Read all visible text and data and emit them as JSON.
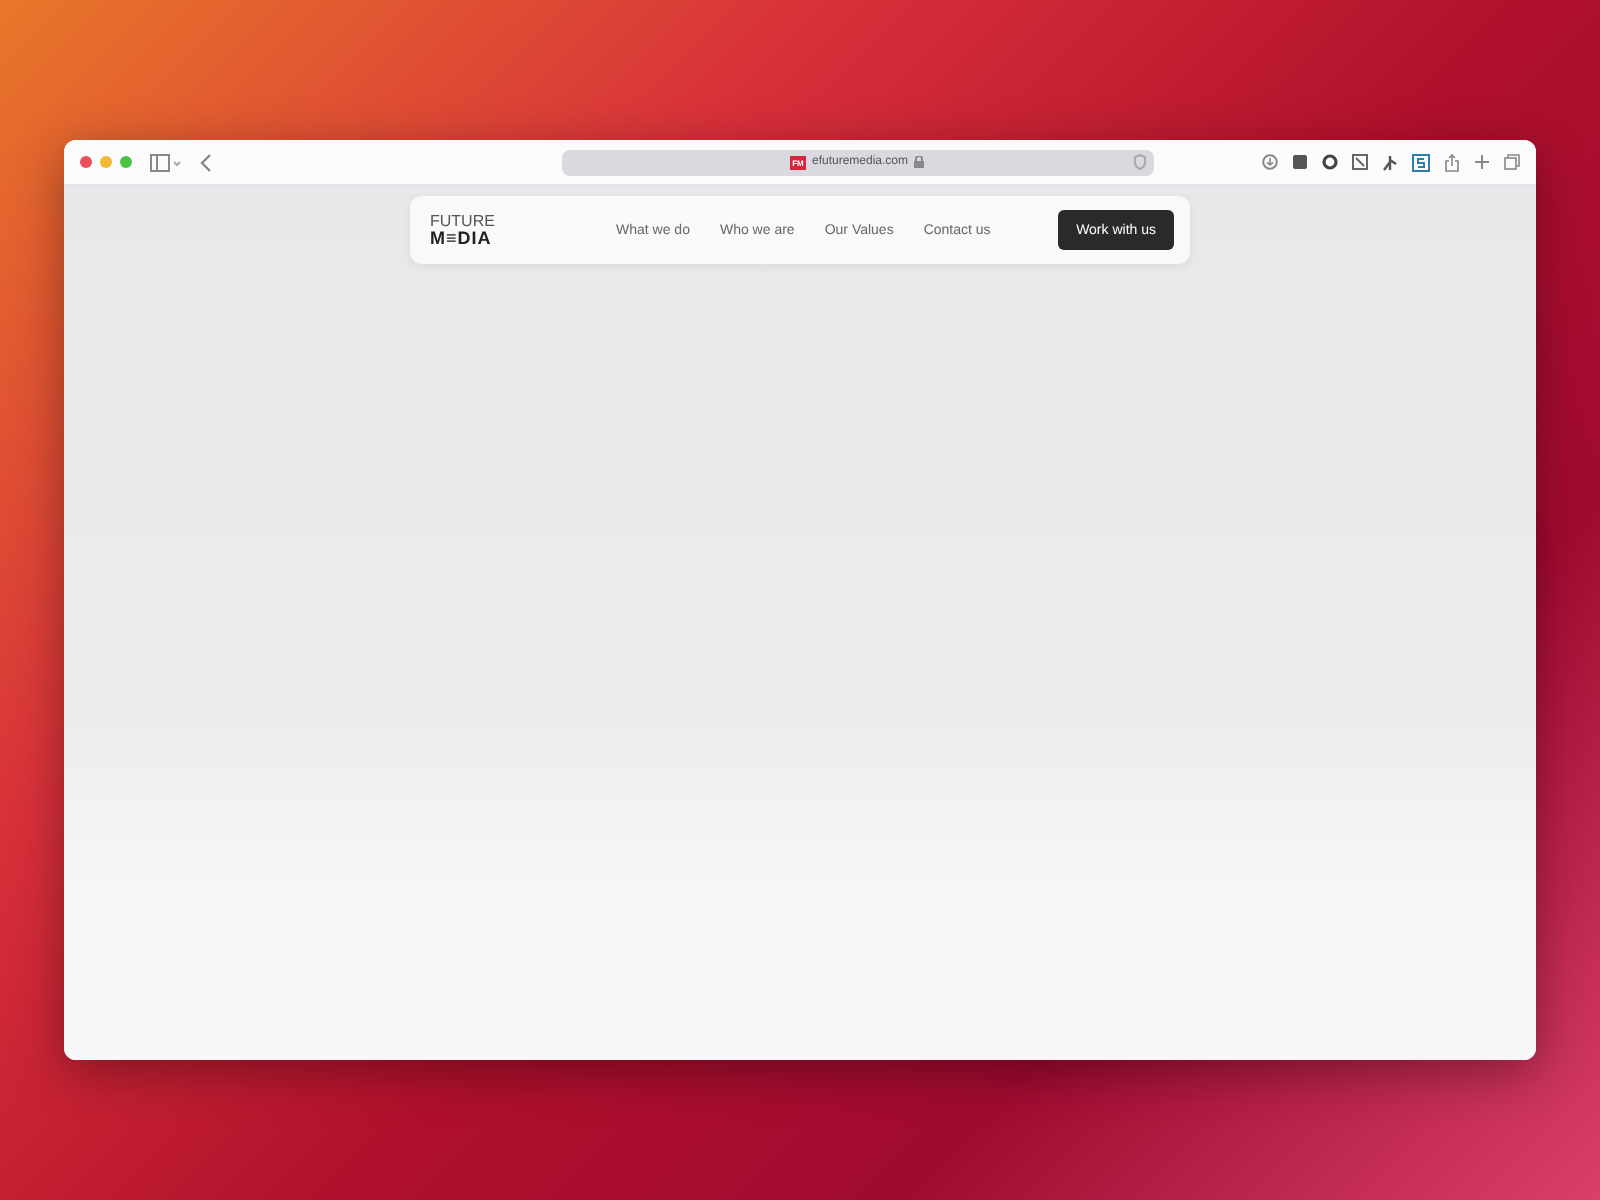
{
  "browser": {
    "url": "efuturemedia.com",
    "favicon": "FM"
  },
  "site": {
    "logo": [
      "FUTURE",
      "M≡DIA"
    ],
    "nav": [
      {
        "label": "What we do"
      },
      {
        "label": "Who we are"
      },
      {
        "label": "Our Values"
      },
      {
        "label": "Contact us"
      }
    ],
    "cta": "Work with us"
  }
}
